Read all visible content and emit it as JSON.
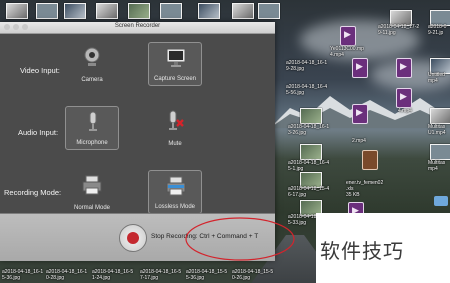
{
  "window": {
    "title": "Screen Recorder",
    "rows": [
      {
        "label": "Video Input:",
        "options": [
          {
            "label": "Camera",
            "icon": "webcam-icon",
            "selected": false
          },
          {
            "label": "Capture Screen",
            "icon": "monitor-icon",
            "selected": true
          }
        ]
      },
      {
        "label": "Audio Input:",
        "options": [
          {
            "label": "Microphone",
            "icon": "microphone-icon",
            "selected": true
          },
          {
            "label": "Mute",
            "icon": "muted-microphone-icon",
            "selected": false
          }
        ]
      },
      {
        "label": "Recording Mode:",
        "options": [
          {
            "label": "Normal Mode",
            "icon": "printer-icon",
            "selected": false
          },
          {
            "label": "Lossless Mode",
            "icon": "lossless-printer-icon",
            "selected": true
          }
        ]
      }
    ],
    "stop_label": "Stop Recording: Ctrl + Command + T"
  },
  "desktop": {
    "right_files": [
      {
        "label": "a2018-04-18_17-2\n9-11.jpg"
      },
      {
        "label": "a2018-0\n9-21.jp"
      },
      {
        "label": "Ye0113C00.mp\n4.mp4"
      },
      {
        "label": "Untitled\nmp4"
      },
      {
        "label": "a2018-04-18_16-1\n3-26.jpg"
      },
      {
        "label": "4.mp4"
      },
      {
        "label": "Multitas\nU1.mp4"
      },
      {
        "label": "a2018-04-18_16-4\n5-1.jpg"
      },
      {
        "label": "2.mp4"
      },
      {
        "label": "Multitas\nmp4"
      },
      {
        "label": "a2018-04-18_15-4\n6-17.jpg"
      },
      {
        "label": "ener.tv_femen02\n.xls\n35 KB"
      },
      {
        "label": "a2018-04-18_15-5\n5-33.jpg"
      }
    ],
    "left_col_labels": [
      "a2018-04-18_16-1\n9-28.jpg",
      "a2018-04-18_16-4\n5-56.jpg"
    ],
    "bottom_files": [
      {
        "label": "a2018-04-18_16-1\n5-36.jpg"
      },
      {
        "label": "a2018-04-18_16-1\n0-28.jpg"
      },
      {
        "label": "a2018-04-18_16-5\n1-24.jpg"
      },
      {
        "label": "a2018-04-18_16-5\n7-17.jpg"
      },
      {
        "label": "a2018-04-18_15-5\n5-36.jpg"
      },
      {
        "label": "a2018-04-18_15-5\n0-26.jpg"
      }
    ]
  },
  "watermark": "软件技巧",
  "colors": {
    "record_red": "#c4282f",
    "highlight_red": "#d3242c",
    "window_bg": "#4b4b4b"
  }
}
